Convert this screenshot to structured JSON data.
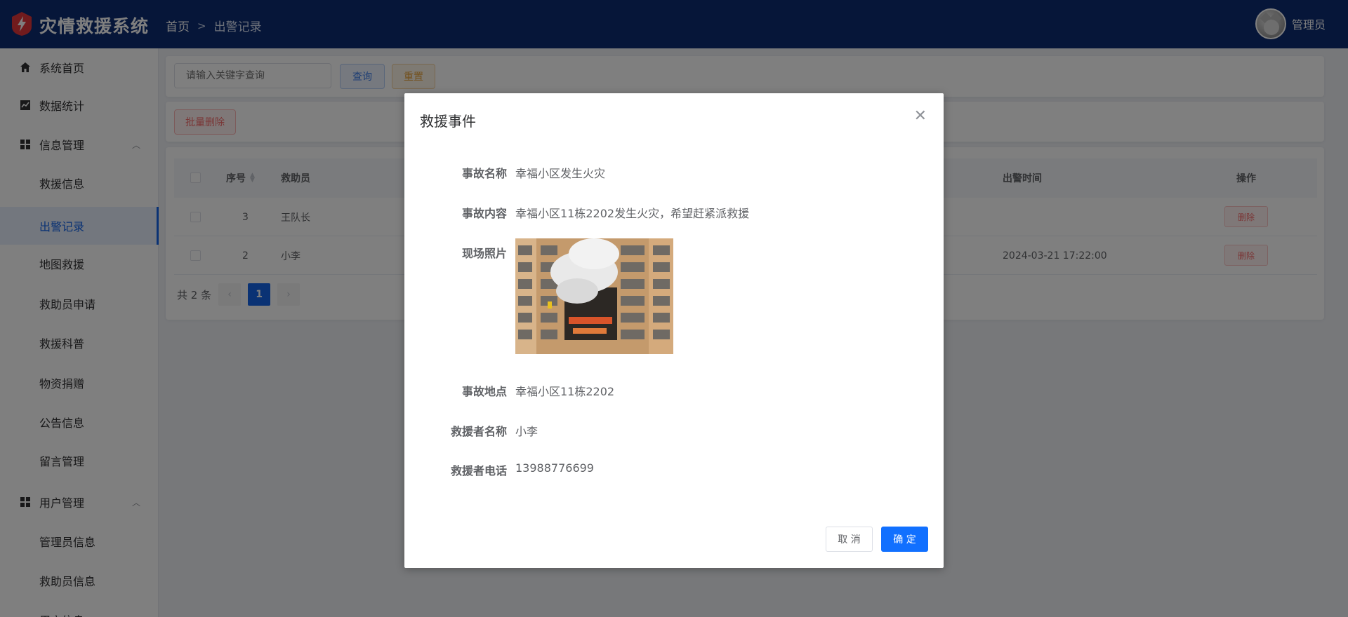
{
  "header": {
    "app_title": "灾情救援系统",
    "breadcrumb": [
      "首页",
      "出警记录"
    ],
    "user_name": "管理员"
  },
  "sidebar": {
    "items": [
      {
        "label": "系统首页",
        "icon": "home-icon"
      },
      {
        "label": "数据统计",
        "icon": "chart-icon"
      },
      {
        "label": "信息管理",
        "icon": "grid-icon",
        "expandable": true
      },
      {
        "label": "救援信息"
      },
      {
        "label": "出警记录",
        "active": true
      },
      {
        "label": "地图救援"
      },
      {
        "label": "救助员申请"
      },
      {
        "label": "救援科普"
      },
      {
        "label": "物资捐赠"
      },
      {
        "label": "公告信息"
      },
      {
        "label": "留言管理"
      },
      {
        "label": "用户管理",
        "icon": "grid-icon",
        "expandable": true
      },
      {
        "label": "管理员信息"
      },
      {
        "label": "救助员信息"
      },
      {
        "label": "用户信息"
      }
    ]
  },
  "toolbar": {
    "search_placeholder": "请输入关键字查询",
    "query_label": "查询",
    "reset_label": "重置",
    "batch_delete_label": "批量删除"
  },
  "table": {
    "headers": {
      "index": "序号",
      "rescuer": "救助员",
      "time": "出警时间",
      "action": "操作"
    },
    "rows": [
      {
        "index": "3",
        "rescuer": "王队长",
        "time": "",
        "action": "删除"
      },
      {
        "index": "2",
        "rescuer": "小李",
        "time": "2024-03-21 17:22:00",
        "action": "删除"
      }
    ]
  },
  "pagination": {
    "total_text": "共 2 条",
    "current_page": "1",
    "prev": "‹",
    "next": "›"
  },
  "dialog": {
    "title": "救援事件",
    "fields": {
      "name_label": "事故名称",
      "name_value": "幸福小区发生火灾",
      "content_label": "事故内容",
      "content_value": "幸福小区11栋2202发生火灾，希望赶紧派救援",
      "photo_label": "现场照片",
      "location_label": "事故地点",
      "location_value": "幸福小区11栋2202",
      "rescuer_label": "救援者名称",
      "rescuer_value": "小李",
      "phone_label": "救援者电话",
      "phone_value": "13988776699"
    },
    "cancel_label": "取 消",
    "ok_label": "确 定"
  },
  "colors": {
    "header_bg": "#0c2c72",
    "primary": "#1170ff",
    "danger": "#f56c6c",
    "warning": "#e6a23c"
  }
}
